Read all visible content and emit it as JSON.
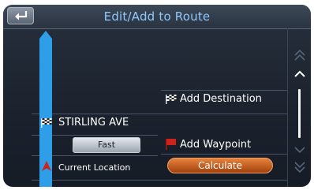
{
  "header": {
    "title": "Edit/Add to Route"
  },
  "route": {
    "destination_label": "Add Destination",
    "destination_name": "STIRLING AVE",
    "route_option": "Fast",
    "waypoint_label": "Add Waypoint",
    "origin_label": "Current Location",
    "calculate_label": "Calculate"
  },
  "colors": {
    "accent": "#2f9ee8",
    "title": "#8ec8ff",
    "calculate": "#c0561a",
    "waypoint_flag": "#d0221a"
  },
  "icons": [
    "back-arrow-icon",
    "checkered-flag-icon",
    "red-flag-icon",
    "location-arrow-icon",
    "scroll-top-icon",
    "scroll-up-icon",
    "scroll-down-icon",
    "scroll-bottom-icon"
  ]
}
